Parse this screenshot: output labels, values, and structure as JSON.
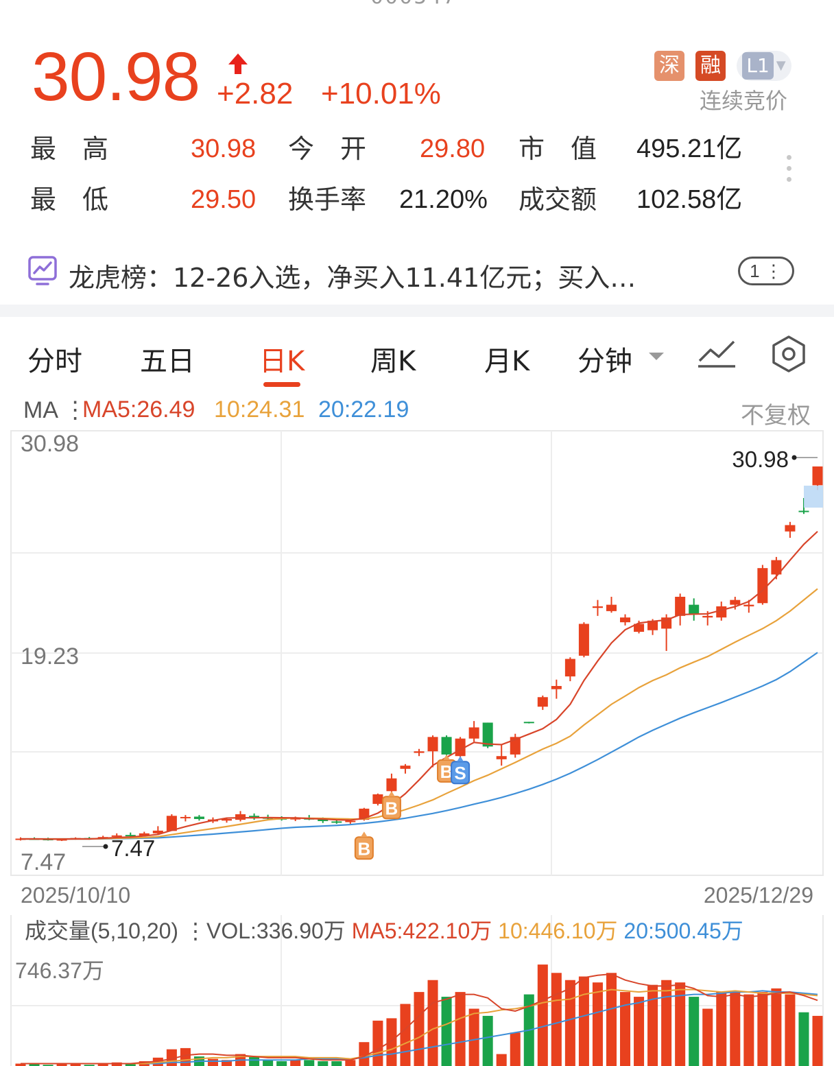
{
  "quote": {
    "price": "30.98",
    "change": "+2.82",
    "change_pct": "+10.01%",
    "direction_color": "#e8411e"
  },
  "badges": {
    "exchange": "深",
    "margin": "融",
    "level": "L1",
    "auction_status": "连续竞价"
  },
  "stats": {
    "high_label": "最　高",
    "high_value": "30.98",
    "open_label": "今　开",
    "open_value": "29.80",
    "mcap_label": "市　值",
    "mcap_value": "495.21亿",
    "low_label": "最　低",
    "low_value": "29.50",
    "turnover_label": "换手率",
    "turnover_value": "21.20%",
    "amount_label": "成交额",
    "amount_value": "102.58亿"
  },
  "longhubang": {
    "text": "龙虎榜：12-26入选，净买入11.41亿元；买入…",
    "count": "1"
  },
  "tabs": [
    {
      "label": "分时"
    },
    {
      "label": "五日"
    },
    {
      "label": "日K"
    },
    {
      "label": "周K"
    },
    {
      "label": "月K"
    },
    {
      "label": "分钟"
    }
  ],
  "active_tab": "日K",
  "ma_line": {
    "label": "MA",
    "ma5": "MA5:26.49",
    "ma10": "10:24.31",
    "ma20": "20:22.19",
    "adjust": "不复权"
  },
  "price_axis": {
    "top": "30.98",
    "mid": "19.23",
    "bottom": "7.47",
    "high_marker": "30.98",
    "low_marker": "7.47"
  },
  "dates": {
    "start": "2025/10/10",
    "end": "2025/12/29"
  },
  "volume": {
    "header": "成交量(5,10,20)",
    "vol": "VOL:336.90万",
    "ma5": "MA5:422.10万",
    "ma10": "10:446.10万",
    "ma20": "20:500.45万",
    "axis_top": "746.37万"
  },
  "colors": {
    "up": "#e8411e",
    "down": "#1aa34a",
    "ma5": "#d8452a",
    "ma10": "#e8a23b",
    "ma20": "#3e8fd8"
  },
  "chart_data": {
    "type": "candlestick",
    "x_range": [
      "2025/10/10",
      "2025/12/29"
    ],
    "ylim": [
      7.47,
      30.98
    ],
    "candles": [
      {
        "o": 7.6,
        "h": 7.7,
        "l": 7.5,
        "c": 7.62
      },
      {
        "o": 7.62,
        "h": 7.7,
        "l": 7.55,
        "c": 7.6
      },
      {
        "o": 7.6,
        "h": 7.68,
        "l": 7.5,
        "c": 7.55
      },
      {
        "o": 7.5,
        "h": 7.62,
        "l": 7.47,
        "c": 7.58
      },
      {
        "o": 7.58,
        "h": 7.7,
        "l": 7.55,
        "c": 7.66
      },
      {
        "o": 7.66,
        "h": 7.72,
        "l": 7.55,
        "c": 7.6
      },
      {
        "o": 7.62,
        "h": 7.8,
        "l": 7.58,
        "c": 7.72
      },
      {
        "o": 7.75,
        "h": 7.95,
        "l": 7.7,
        "c": 7.82
      },
      {
        "o": 7.85,
        "h": 8.0,
        "l": 7.72,
        "c": 7.78
      },
      {
        "o": 7.8,
        "h": 8.05,
        "l": 7.75,
        "c": 7.95
      },
      {
        "o": 7.95,
        "h": 8.4,
        "l": 7.9,
        "c": 8.12
      },
      {
        "o": 8.1,
        "h": 9.15,
        "l": 8.1,
        "c": 9.05
      },
      {
        "o": 8.9,
        "h": 9.1,
        "l": 8.7,
        "c": 8.98
      },
      {
        "o": 9.0,
        "h": 9.1,
        "l": 8.75,
        "c": 8.85
      },
      {
        "o": 8.7,
        "h": 8.95,
        "l": 8.6,
        "c": 8.82
      },
      {
        "o": 8.75,
        "h": 8.95,
        "l": 8.62,
        "c": 8.85
      },
      {
        "o": 8.8,
        "h": 9.35,
        "l": 8.7,
        "c": 9.15
      },
      {
        "o": 9.05,
        "h": 9.2,
        "l": 8.8,
        "c": 9.0
      },
      {
        "o": 8.95,
        "h": 9.12,
        "l": 8.8,
        "c": 8.9
      },
      {
        "o": 8.9,
        "h": 9.02,
        "l": 8.75,
        "c": 8.82
      },
      {
        "o": 8.82,
        "h": 9.0,
        "l": 8.72,
        "c": 8.92
      },
      {
        "o": 8.9,
        "h": 9.1,
        "l": 8.78,
        "c": 8.84
      },
      {
        "o": 8.84,
        "h": 8.95,
        "l": 8.6,
        "c": 8.72
      },
      {
        "o": 8.7,
        "h": 8.82,
        "l": 8.55,
        "c": 8.68
      },
      {
        "o": 8.68,
        "h": 8.82,
        "l": 8.55,
        "c": 8.74
      },
      {
        "o": 8.8,
        "h": 9.55,
        "l": 8.75,
        "c": 9.5
      },
      {
        "o": 9.8,
        "h": 10.45,
        "l": 9.7,
        "c": 10.4
      },
      {
        "o": 10.6,
        "h": 11.7,
        "l": 10.5,
        "c": 11.4
      },
      {
        "o": 12.0,
        "h": 12.3,
        "l": 11.7,
        "c": 12.2
      },
      {
        "o": 13.0,
        "h": 13.25,
        "l": 12.8,
        "c": 13.1
      },
      {
        "o": 13.1,
        "h": 14.1,
        "l": 12.1,
        "c": 14.0
      },
      {
        "o": 14.0,
        "h": 14.1,
        "l": 12.7,
        "c": 12.9
      },
      {
        "o": 12.8,
        "h": 14.0,
        "l": 12.3,
        "c": 13.9
      },
      {
        "o": 13.9,
        "h": 15.0,
        "l": 13.7,
        "c": 14.6
      },
      {
        "o": 14.9,
        "h": 14.9,
        "l": 13.3,
        "c": 13.4
      },
      {
        "o": 12.6,
        "h": 13.5,
        "l": 12.2,
        "c": 12.8
      },
      {
        "o": 12.9,
        "h": 14.2,
        "l": 12.7,
        "c": 14.0
      },
      {
        "o": 14.95,
        "h": 14.95,
        "l": 14.85,
        "c": 14.92
      },
      {
        "o": 15.9,
        "h": 16.6,
        "l": 15.7,
        "c": 16.5
      },
      {
        "o": 17.0,
        "h": 17.6,
        "l": 16.4,
        "c": 17.2
      },
      {
        "o": 17.8,
        "h": 19.0,
        "l": 17.5,
        "c": 18.9
      },
      {
        "o": 19.1,
        "h": 21.2,
        "l": 19.0,
        "c": 21.1
      },
      {
        "o": 22.1,
        "h": 22.6,
        "l": 21.6,
        "c": 22.2
      },
      {
        "o": 21.9,
        "h": 22.8,
        "l": 21.8,
        "c": 22.3
      },
      {
        "o": 21.2,
        "h": 21.7,
        "l": 21.0,
        "c": 21.5
      },
      {
        "o": 20.6,
        "h": 21.3,
        "l": 20.5,
        "c": 21.1
      },
      {
        "o": 20.7,
        "h": 21.4,
        "l": 20.4,
        "c": 21.3
      },
      {
        "o": 20.8,
        "h": 21.7,
        "l": 19.4,
        "c": 21.5
      },
      {
        "o": 21.6,
        "h": 23.0,
        "l": 21.0,
        "c": 22.8
      },
      {
        "o": 22.3,
        "h": 22.7,
        "l": 21.3,
        "c": 21.7
      },
      {
        "o": 21.5,
        "h": 21.9,
        "l": 21.0,
        "c": 21.6
      },
      {
        "o": 21.5,
        "h": 22.5,
        "l": 21.3,
        "c": 22.2
      },
      {
        "o": 22.3,
        "h": 22.8,
        "l": 22.0,
        "c": 22.6
      },
      {
        "o": 22.2,
        "h": 22.6,
        "l": 21.8,
        "c": 22.3
      },
      {
        "o": 22.4,
        "h": 24.8,
        "l": 22.3,
        "c": 24.6
      },
      {
        "o": 24.2,
        "h": 25.3,
        "l": 23.9,
        "c": 25.1
      },
      {
        "o": 26.9,
        "h": 27.5,
        "l": 26.5,
        "c": 27.3
      },
      {
        "o": 28.2,
        "h": 29.0,
        "l": 28.0,
        "c": 28.16
      },
      {
        "o": 29.8,
        "h": 30.98,
        "l": 29.5,
        "c": 30.98
      }
    ],
    "ma5": [
      7.6,
      7.6,
      7.59,
      7.59,
      7.6,
      7.6,
      7.64,
      7.69,
      7.72,
      7.79,
      7.88,
      8.14,
      8.37,
      8.58,
      8.76,
      8.91,
      8.93,
      8.93,
      8.94,
      8.93,
      8.92,
      8.88,
      8.85,
      8.8,
      8.78,
      8.89,
      9.22,
      9.75,
      10.44,
      11.3,
      12.22,
      12.72,
      13.2,
      13.66,
      13.56,
      13.52,
      13.84,
      14.18,
      14.52,
      15.1,
      16.05,
      17.54,
      18.77,
      19.9,
      20.73,
      21.15,
      21.26,
      21.34,
      21.68,
      21.71,
      21.73,
      21.96,
      22.18,
      22.5,
      23.2,
      24.08,
      25.1,
      26.09,
      26.9
    ],
    "ma10": [
      7.6,
      7.6,
      7.6,
      7.6,
      7.6,
      7.6,
      7.62,
      7.64,
      7.66,
      7.69,
      7.74,
      7.87,
      8.0,
      8.13,
      8.25,
      8.38,
      8.52,
      8.66,
      8.8,
      8.88,
      8.92,
      8.9,
      8.89,
      8.87,
      8.85,
      8.85,
      8.97,
      9.18,
      9.44,
      9.73,
      10.05,
      10.46,
      10.85,
      11.26,
      11.6,
      12.0,
      12.4,
      12.82,
      13.24,
      13.6,
      14.05,
      14.75,
      15.4,
      16.05,
      16.57,
      17.1,
      17.54,
      17.9,
      18.34,
      18.7,
      19.05,
      19.5,
      19.95,
      20.38,
      20.8,
      21.3,
      21.9,
      22.6,
      23.3
    ],
    "ma20": [
      7.6,
      7.6,
      7.6,
      7.6,
      7.6,
      7.6,
      7.61,
      7.62,
      7.63,
      7.65,
      7.67,
      7.72,
      7.78,
      7.84,
      7.9,
      7.97,
      8.04,
      8.11,
      8.19,
      8.27,
      8.33,
      8.37,
      8.41,
      8.45,
      8.5,
      8.58,
      8.67,
      8.78,
      8.9,
      9.05,
      9.2,
      9.38,
      9.57,
      9.78,
      9.98,
      10.2,
      10.45,
      10.72,
      11.02,
      11.35,
      11.72,
      12.14,
      12.58,
      13.05,
      13.52,
      14.0,
      14.42,
      14.8,
      15.18,
      15.52,
      15.84,
      16.16,
      16.5,
      16.84,
      17.2,
      17.6,
      18.1,
      18.7,
      19.3
    ],
    "signals": [
      {
        "index": 25,
        "label": "B"
      },
      {
        "index": 27,
        "label": "B"
      },
      {
        "index": 31,
        "label": "B"
      },
      {
        "index": 32,
        "label": "S"
      }
    ],
    "volume": [
      2,
      2,
      1,
      2,
      2,
      1,
      2,
      3,
      2,
      4,
      7,
      14,
      15,
      8,
      6,
      5,
      10,
      8,
      5,
      4,
      5,
      5,
      4,
      4,
      5,
      20,
      38,
      40,
      52,
      62,
      72,
      58,
      62,
      48,
      42,
      10,
      28,
      60,
      85,
      78,
      72,
      75,
      70,
      78,
      62,
      58,
      68,
      72,
      70,
      58,
      48,
      62,
      62,
      60,
      62,
      65,
      60,
      45,
      42
    ],
    "volume_ma5": [
      2,
      2,
      2,
      2,
      2,
      2,
      2,
      2,
      2,
      3,
      4,
      6,
      9,
      10,
      10,
      9,
      9,
      8,
      7,
      7,
      7,
      6,
      5,
      5,
      5,
      8,
      14,
      21,
      31,
      42,
      53,
      56,
      60,
      60,
      57,
      48,
      46,
      50,
      55,
      60,
      65,
      74,
      76,
      77,
      72,
      69,
      67,
      67,
      68,
      65,
      59,
      58,
      60,
      58,
      59,
      61,
      62,
      59,
      55
    ],
    "volume_ma10": [
      2,
      2,
      2,
      2,
      2,
      2,
      2,
      2,
      2,
      2,
      3,
      4,
      5,
      6,
      7,
      7,
      8,
      8,
      8,
      8,
      8,
      7,
      7,
      7,
      6,
      8,
      11,
      14,
      19,
      24,
      31,
      35,
      40,
      44,
      45,
      47,
      48,
      50,
      53,
      55,
      56,
      60,
      62,
      64,
      63,
      62,
      63,
      63,
      64,
      64,
      63,
      62,
      63,
      62,
      61,
      61,
      61,
      60,
      59
    ],
    "volume_ma20": [
      2,
      2,
      2,
      2,
      2,
      2,
      2,
      2,
      2,
      2,
      2,
      3,
      3,
      4,
      4,
      4,
      5,
      5,
      5,
      5,
      5,
      6,
      6,
      6,
      6,
      7,
      9,
      10,
      12,
      14,
      16,
      18,
      20,
      22,
      24,
      26,
      28,
      30,
      33,
      36,
      39,
      42,
      45,
      48,
      51,
      53,
      56,
      58,
      59,
      60,
      60,
      61,
      62,
      62,
      63,
      62,
      62,
      61,
      60
    ],
    "volume_ylim_label": "746.37万"
  }
}
